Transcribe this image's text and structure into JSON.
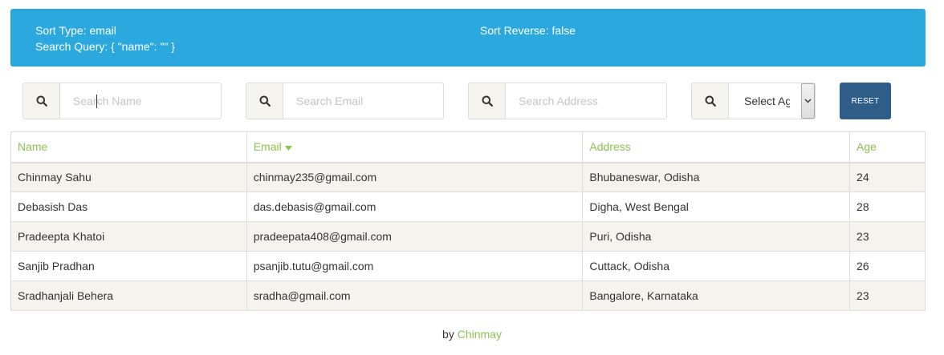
{
  "info": {
    "sort_type": "Sort Type: email",
    "search_query": "Search Query: { \"name\": \"\" }",
    "sort_reverse": "Sort Reverse: false"
  },
  "filters": {
    "name_placeholder": "Search Name",
    "email_placeholder": "Search Email",
    "address_placeholder": "Search Address",
    "age_select_value": "Select Age",
    "search_icon": "search-icon",
    "reset_label": "RESET"
  },
  "table": {
    "headers": [
      "Name",
      "Email",
      "Address",
      "Age"
    ],
    "sort_indicator_icon": "caret-down-icon",
    "rows": [
      [
        "Chinmay Sahu",
        "chinmay235@gmail.com",
        "Bhubaneswar, Odisha",
        "24"
      ],
      [
        "Debasish Das",
        "das.debasis@gmail.com",
        "Digha, West Bengal",
        "28"
      ],
      [
        "Pradeepta Khatoi",
        "pradeepata408@gmail.com",
        "Puri, Odisha",
        "23"
      ],
      [
        "Sanjib Pradhan",
        "psanjib.tutu@gmail.com",
        "Cuttack, Odisha",
        "26"
      ],
      [
        "Sradhanjali Behera",
        "sradha@gmail.com",
        "Bangalore, Karnataka",
        "23"
      ]
    ]
  },
  "footer": {
    "by": "by",
    "author": "Chinmay"
  },
  "colors": {
    "info_panel": "#2ba9de",
    "header_text": "#8dc153",
    "reset_button": "#2e5d8a",
    "stripe": "#f6f3ee"
  }
}
